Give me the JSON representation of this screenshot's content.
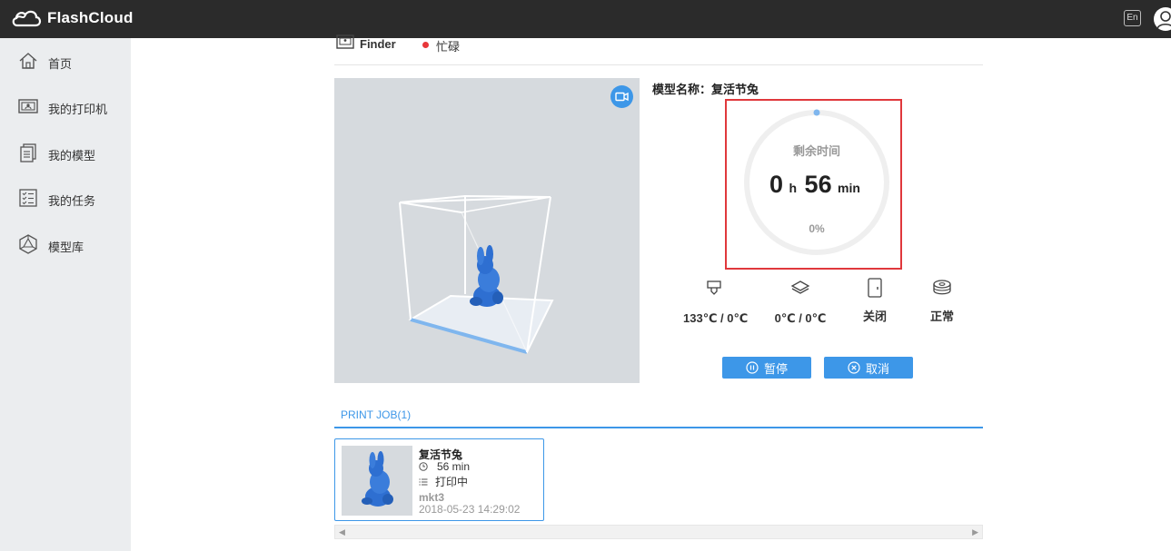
{
  "app": {
    "brand": "FlashCloud",
    "lang_button": "En",
    "user_icon": "user-icon"
  },
  "sidebar": {
    "items": [
      {
        "label": "首页",
        "icon": "home-icon"
      },
      {
        "label": "我的打印机",
        "icon": "printer-icon"
      },
      {
        "label": "我的模型",
        "icon": "models-icon"
      },
      {
        "label": "我的任务",
        "icon": "tasks-icon"
      },
      {
        "label": "模型库",
        "icon": "model-library-icon"
      }
    ]
  },
  "printer": {
    "name": "Finder",
    "status": "忙碌",
    "status_color": "#e8373a"
  },
  "model": {
    "name_label": "模型名称：复活节兔",
    "remaining_label": "剩余时间",
    "hours": "0",
    "hours_unit": "h",
    "minutes": "56",
    "minutes_unit": "min",
    "progress_text": "0%",
    "progress": 0
  },
  "stats": [
    {
      "icon": "nozzle-icon",
      "value": "133℃ / 0℃"
    },
    {
      "icon": "bed-layers-icon",
      "value": "0℃ / 0℃"
    },
    {
      "icon": "door-icon",
      "value": "关闭"
    },
    {
      "icon": "filament-spool-icon",
      "value": "正常"
    }
  ],
  "actions": {
    "pause": "暂停",
    "cancel": "取消"
  },
  "jobs": {
    "tab_label": "PRINT JOB(1)",
    "items": [
      {
        "title": "复活节兔",
        "duration": "56 min",
        "status": "打印中",
        "printer": "mkt3",
        "date": "2018-05-23 14:29:02"
      }
    ]
  },
  "colors": {
    "accent": "#3d97e8",
    "topbar": "#2b2b2b",
    "sidebar": "#ebedef",
    "highlight": "#e0383c",
    "model_blue": "#2e6fd1"
  }
}
